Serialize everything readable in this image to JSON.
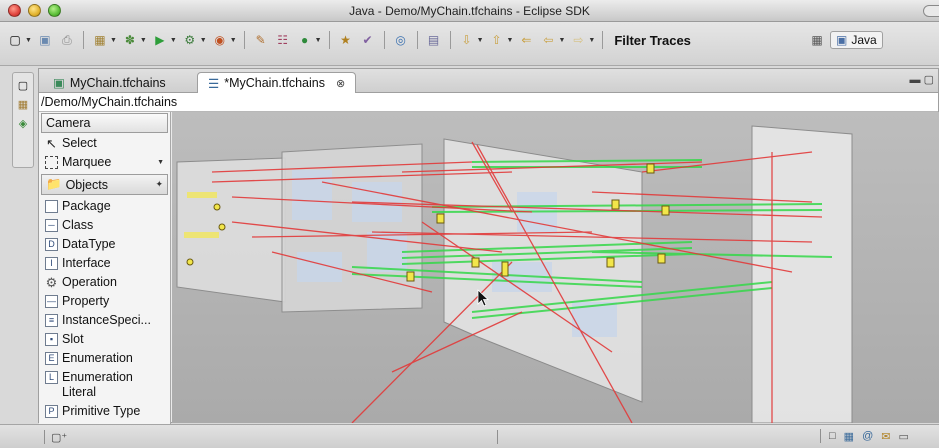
{
  "window": {
    "title": "Java - Demo/MyChain.tfchains - Eclipse SDK"
  },
  "toolbar": {
    "filter_traces_label": "Filter Traces",
    "perspective_label": "Java"
  },
  "editor": {
    "tabs": [
      {
        "label": "MyChain.tfchains",
        "active": false
      },
      {
        "label": "*MyChain.tfchains",
        "active": true
      }
    ],
    "breadcrumb": "/Demo/MyChain.tfchains"
  },
  "palette": {
    "header": "Camera",
    "tools": [
      {
        "label": "Select",
        "icon": "cursor-arrow-icon"
      },
      {
        "label": "Marquee",
        "icon": "marquee-icon"
      }
    ],
    "drawer_label": "Objects",
    "items": [
      {
        "label": "Package",
        "icon": "package-icon"
      },
      {
        "label": "Class",
        "icon": "class-icon"
      },
      {
        "label": "DataType",
        "icon": "datatype-icon"
      },
      {
        "label": "Interface",
        "icon": "interface-icon"
      },
      {
        "label": "Operation",
        "icon": "operation-icon"
      },
      {
        "label": "Property",
        "icon": "property-icon"
      },
      {
        "label": "InstanceSpeci...",
        "icon": "instance-specification-icon"
      },
      {
        "label": "Slot",
        "icon": "slot-icon"
      },
      {
        "label": "Enumeration",
        "icon": "enumeration-icon"
      },
      {
        "label": "Enumeration Literal",
        "icon": "enumeration-literal-icon"
      },
      {
        "label": "Primitive Type",
        "icon": "primitive-type-icon"
      }
    ]
  },
  "colors": {
    "trace_red": "#e23a3a",
    "trace_green": "#35d84a",
    "node_yellow": "#f2e64a",
    "canvas_bg": "#b5b5b5"
  }
}
